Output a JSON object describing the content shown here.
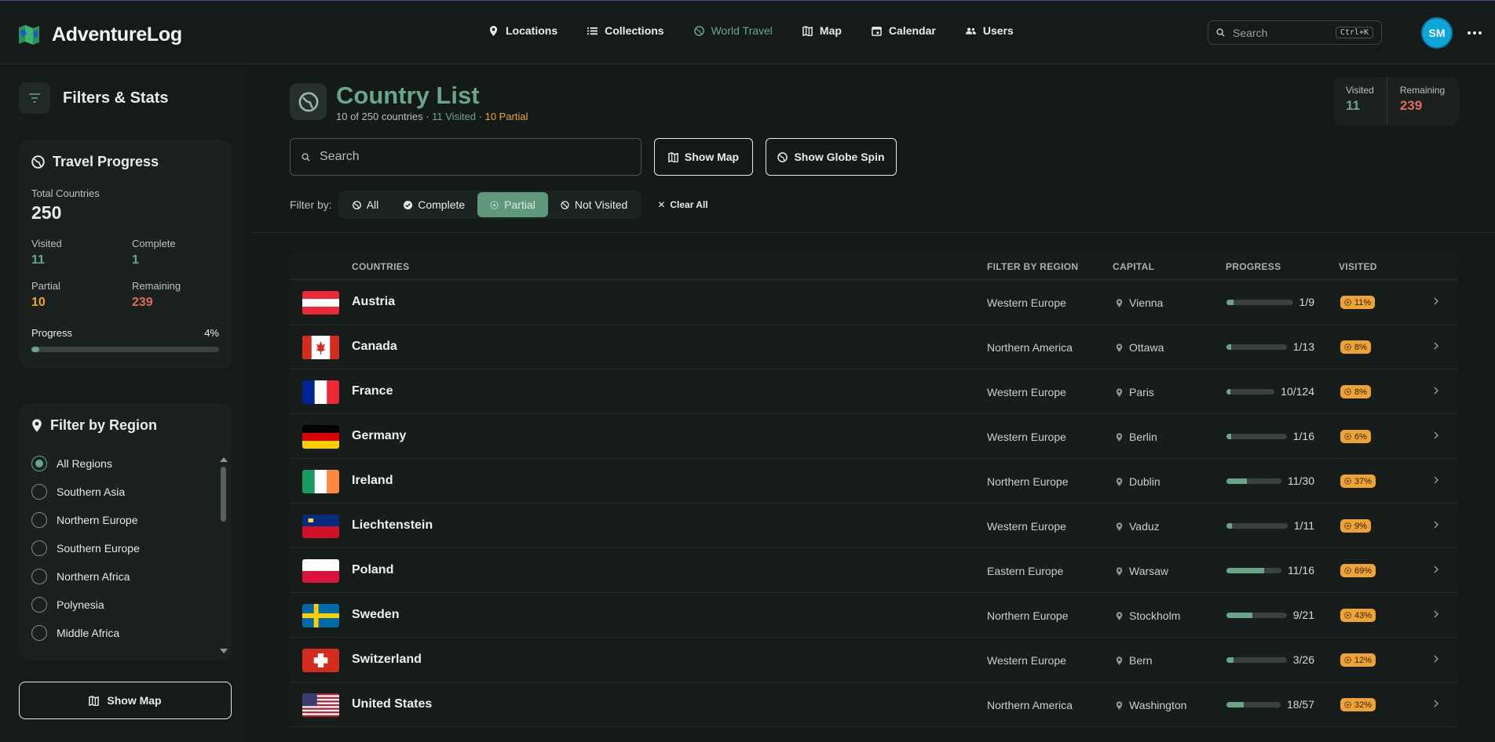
{
  "app": {
    "name": "AdventureLog",
    "user_initials": "SM"
  },
  "nav": [
    {
      "label": "Locations",
      "icon": "map-pin-icon",
      "active": false
    },
    {
      "label": "Collections",
      "icon": "list-icon",
      "active": false
    },
    {
      "label": "World Travel",
      "icon": "globe-icon",
      "active": true
    },
    {
      "label": "Map",
      "icon": "map-icon",
      "active": false
    },
    {
      "label": "Calendar",
      "icon": "calendar-icon",
      "active": false
    },
    {
      "label": "Users",
      "icon": "users-icon",
      "active": false
    }
  ],
  "top_search": {
    "placeholder": "Search",
    "shortcut": "Ctrl+K"
  },
  "sidebar": {
    "title": "Filters & Stats",
    "travel_progress": {
      "title": "Travel Progress",
      "total_label": "Total Countries",
      "total_value": "250",
      "visited_label": "Visited",
      "visited_value": "11",
      "complete_label": "Complete",
      "complete_value": "1",
      "partial_label": "Partial",
      "partial_value": "10",
      "remaining_label": "Remaining",
      "remaining_value": "239",
      "progress_label": "Progress",
      "progress_value": "4%",
      "progress_fraction": 0.04
    },
    "region_filter": {
      "title": "Filter by Region",
      "options": [
        "All Regions",
        "Southern Asia",
        "Northern Europe",
        "Southern Europe",
        "Northern Africa",
        "Polynesia",
        "Middle Africa"
      ],
      "selected": "All Regions"
    },
    "show_map_label": "Show Map"
  },
  "main": {
    "title": "Country List",
    "subtitle_count": "10 of 250 countries",
    "subtitle_visited": "11 Visited",
    "subtitle_partial": "10 Partial",
    "stat_visited_label": "Visited",
    "stat_visited_value": "11",
    "stat_remaining_label": "Remaining",
    "stat_remaining_value": "239",
    "search_placeholder": "Search",
    "show_map_label": "Show Map",
    "show_globe_label": "Show Globe Spin",
    "filter_label": "Filter by:",
    "filters": [
      {
        "label": "All",
        "icon": "globe-icon",
        "active": false
      },
      {
        "label": "Complete",
        "icon": "check-circle-icon",
        "active": false
      },
      {
        "label": "Partial",
        "icon": "partial-circle-icon",
        "active": true
      },
      {
        "label": "Not Visited",
        "icon": "ban-icon",
        "active": false
      }
    ],
    "clear_all_label": "Clear All"
  },
  "table": {
    "headers": {
      "countries": "COUNTRIES",
      "region": "FILTER BY REGION",
      "capital": "CAPITAL",
      "progress": "PROGRESS",
      "visited": "VISITED"
    },
    "rows": [
      {
        "name": "Austria",
        "flag": "austria",
        "region": "Western Europe",
        "capital": "Vienna",
        "progress": "1/9",
        "fraction": 0.11,
        "visited": "11%"
      },
      {
        "name": "Canada",
        "flag": "canada",
        "region": "Northern America",
        "capital": "Ottawa",
        "progress": "1/13",
        "fraction": 0.08,
        "visited": "8%"
      },
      {
        "name": "France",
        "flag": "france",
        "region": "Western Europe",
        "capital": "Paris",
        "progress": "10/124",
        "fraction": 0.08,
        "visited": "8%"
      },
      {
        "name": "Germany",
        "flag": "germany",
        "region": "Western Europe",
        "capital": "Berlin",
        "progress": "1/16",
        "fraction": 0.06,
        "visited": "6%"
      },
      {
        "name": "Ireland",
        "flag": "ireland",
        "region": "Northern Europe",
        "capital": "Dublin",
        "progress": "11/30",
        "fraction": 0.37,
        "visited": "37%"
      },
      {
        "name": "Liechtenstein",
        "flag": "liechtenstein",
        "region": "Western Europe",
        "capital": "Vaduz",
        "progress": "1/11",
        "fraction": 0.09,
        "visited": "9%"
      },
      {
        "name": "Poland",
        "flag": "poland",
        "region": "Eastern Europe",
        "capital": "Warsaw",
        "progress": "11/16",
        "fraction": 0.69,
        "visited": "69%"
      },
      {
        "name": "Sweden",
        "flag": "sweden",
        "region": "Northern Europe",
        "capital": "Stockholm",
        "progress": "9/21",
        "fraction": 0.43,
        "visited": "43%"
      },
      {
        "name": "Switzerland",
        "flag": "switzerland",
        "region": "Western Europe",
        "capital": "Bern",
        "progress": "3/26",
        "fraction": 0.12,
        "visited": "12%"
      },
      {
        "name": "United States",
        "flag": "usa",
        "region": "Northern America",
        "capital": "Washington",
        "progress": "18/57",
        "fraction": 0.32,
        "visited": "32%"
      }
    ]
  },
  "colors": {
    "accent": "#6aa58a",
    "partial": "#f0a335",
    "remaining": "#e06b5e",
    "background": "#141a17"
  }
}
